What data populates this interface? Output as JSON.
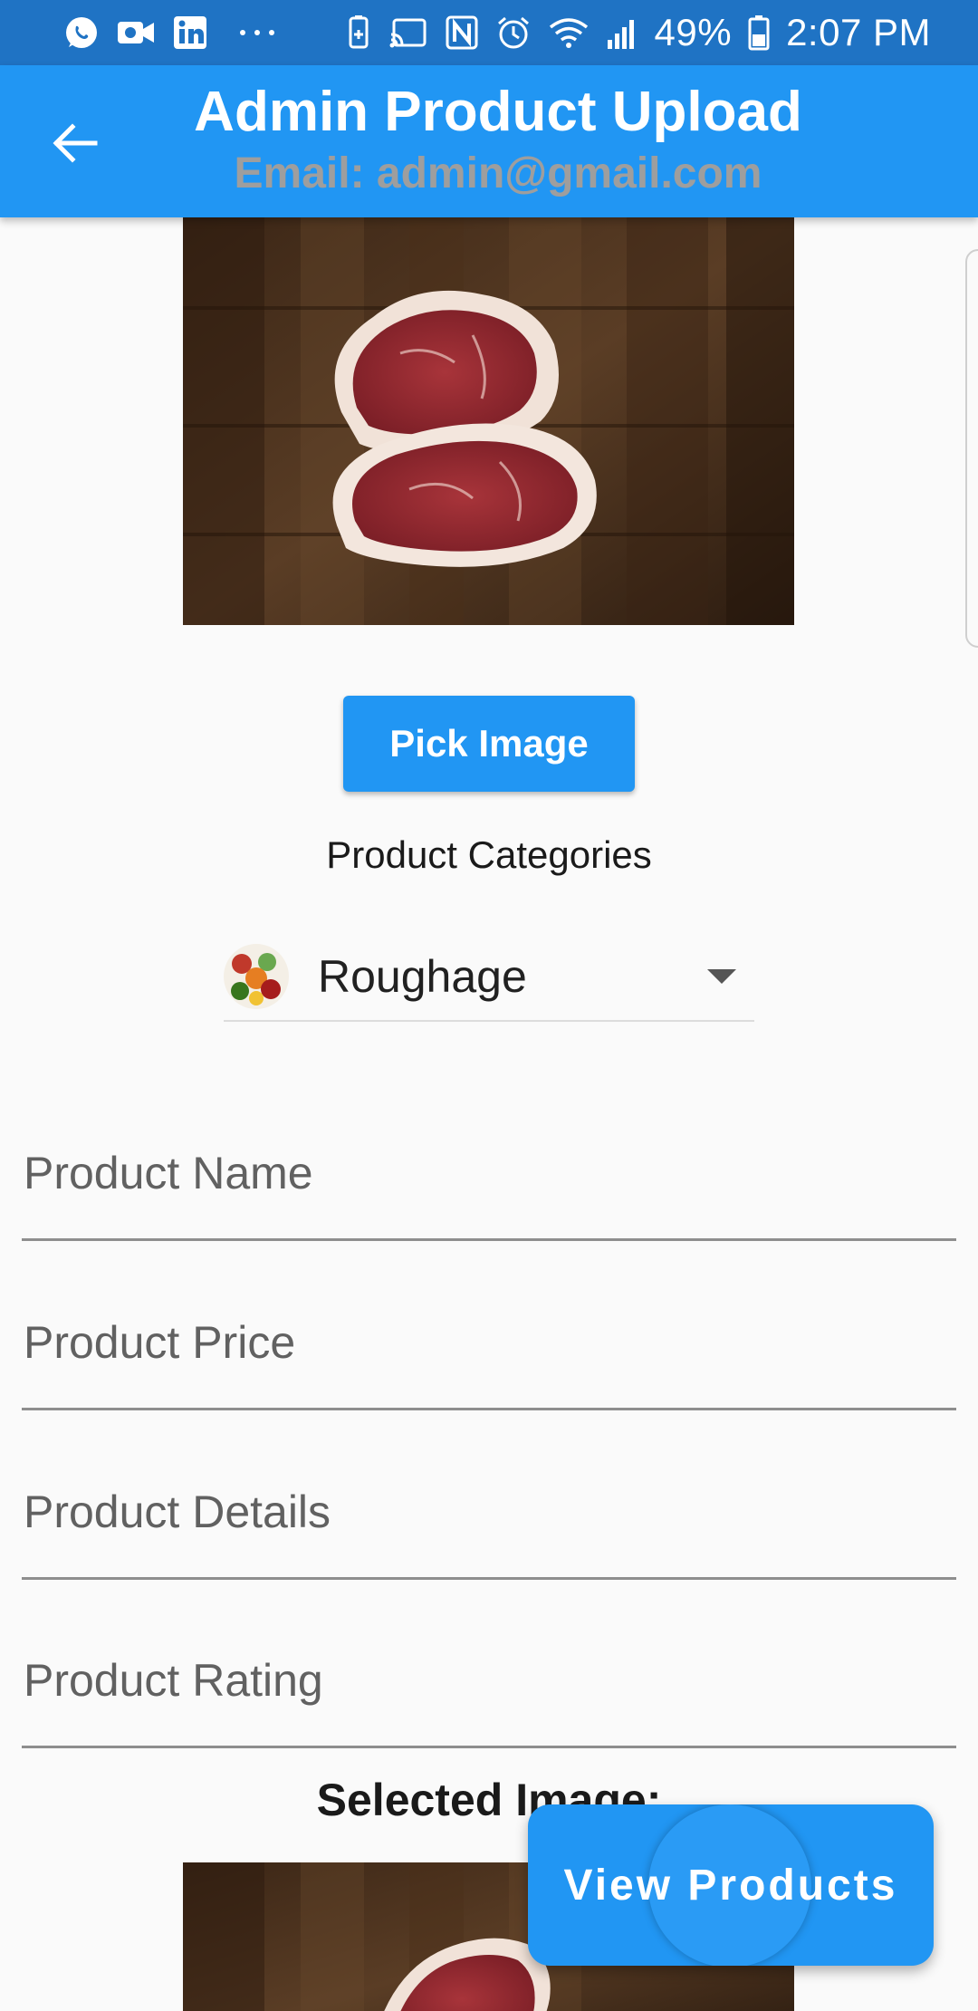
{
  "status_bar": {
    "battery": "49%",
    "time": "2:07 PM",
    "left_icons": [
      "whatsapp-icon",
      "video-call-icon",
      "linkedin-icon",
      "more-dots-icon"
    ],
    "right_icons": [
      "battery-saver-icon",
      "cast-icon",
      "nfc-icon",
      "alarm-icon",
      "wifi-icon",
      "signal-icon",
      "battery-icon"
    ]
  },
  "app_bar": {
    "title": "Admin Product Upload",
    "subtitle": "Email: admin@gmail.com",
    "back_icon": "arrow-back-icon"
  },
  "form": {
    "pick_image_label": "Pick Image",
    "categories_label": "Product Categories",
    "category_selected": "Roughage",
    "fields": {
      "name_placeholder": "Product Name",
      "price_placeholder": "Product Price",
      "details_placeholder": "Product Details",
      "rating_placeholder": "Product Rating"
    },
    "selected_image_label": "Selected Image:"
  },
  "fab": {
    "label": "View Products"
  },
  "colors": {
    "status_bar": "#1f73c4",
    "app_bar": "#2196f3",
    "accent": "#2196f3",
    "subtitle": "#9e9e9e",
    "background": "#fafafa"
  }
}
